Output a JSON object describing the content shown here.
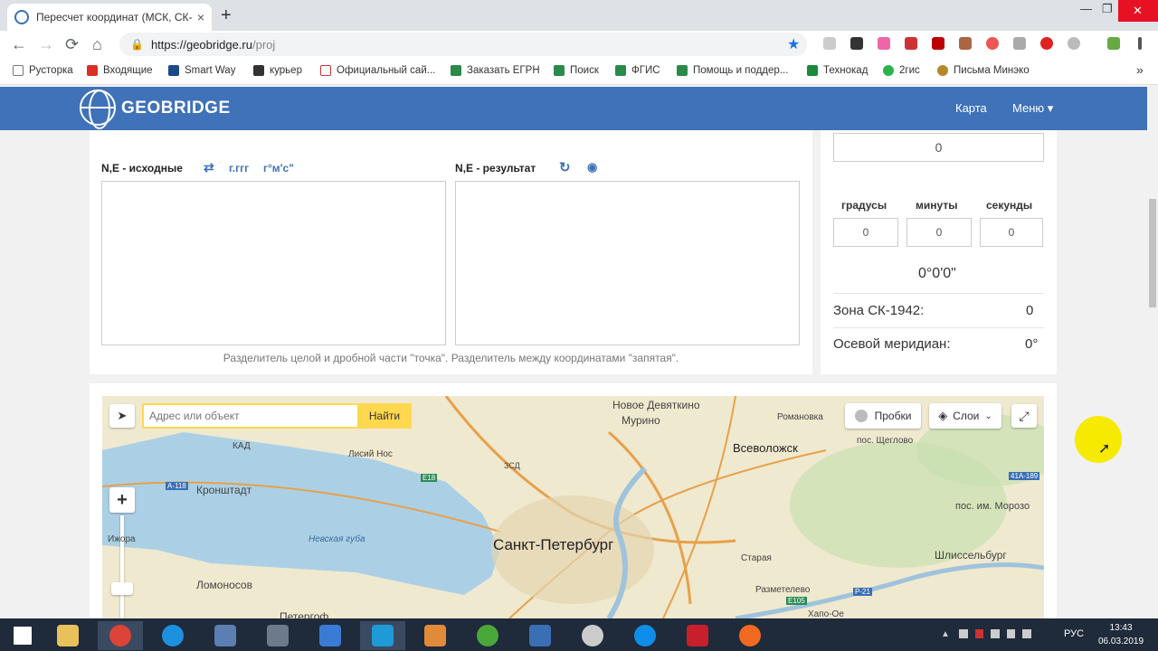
{
  "browser": {
    "tab_title": "Пересчет координат (МСК, СК-",
    "tab_close": "×",
    "new_tab": "+",
    "url_host": "https://geobridge.ru",
    "url_path": "/proj",
    "nav_back": "←",
    "nav_forward": "→",
    "nav_reload": "⟳",
    "nav_home": "⌂",
    "star": "★",
    "lock": "🔒",
    "win_min": "—",
    "win_restore": "❐",
    "win_close": "✕"
  },
  "bookmarks": [
    {
      "label": "Русторка"
    },
    {
      "label": "Входящие"
    },
    {
      "label": "Smart Way"
    },
    {
      "label": "курьер"
    },
    {
      "label": "Официальный сай..."
    },
    {
      "label": "Заказать ЕГРН"
    },
    {
      "label": "Поиск"
    },
    {
      "label": "ФГИС"
    },
    {
      "label": "Помощь и поддер..."
    },
    {
      "label": "Технокад"
    },
    {
      "label": "2гис"
    },
    {
      "label": "Письма Минэко"
    }
  ],
  "bookmarks_more": "»",
  "site": {
    "brand": "GEOBRIDGE",
    "nav_map": "Карта",
    "nav_menu": "Меню ▾"
  },
  "converter": {
    "source_label": "N,E - исходные",
    "swap_icon": "⇄",
    "fmt_decimal": "г.ггг",
    "fmt_dms": "г°м'с\"",
    "result_label": "N,E - результат",
    "refresh_icon": "↻",
    "eye_icon": "◉",
    "hint": "Разделитель целой и дробной части \"точка\". Разделитель между координатами \"запятая\"."
  },
  "angle": {
    "top_value": "0",
    "deg_label": "градусы",
    "min_label": "минуты",
    "sec_label": "секунды",
    "deg_value": "0",
    "min_value": "0",
    "sec_value": "0",
    "dms_display": "0°0'0\"",
    "zone_label": "Зона СК-1942:",
    "zone_value": "0",
    "meridian_label": "Осевой меридиан:",
    "meridian_value": "0°"
  },
  "map": {
    "search_placeholder": "Адрес или объект",
    "search_button": "Найти",
    "traffic": "Пробки",
    "layers": "Слои",
    "zoom_in": "+",
    "locate_icon": "➤",
    "fullscreen_icon": "⤢",
    "labels": [
      {
        "text": "Новое Девяткино"
      },
      {
        "text": "Мурино"
      },
      {
        "text": "Романовка"
      },
      {
        "text": "Всеволожск"
      },
      {
        "text": "пос. Щеглово"
      },
      {
        "text": "КАД"
      },
      {
        "text": "Лисий Нос"
      },
      {
        "text": "Кронштадт"
      },
      {
        "text": "Невская губа"
      },
      {
        "text": "Санкт-Петербург"
      },
      {
        "text": "Старая"
      },
      {
        "text": "Шлиссельбург"
      },
      {
        "text": "пос. им. Морозо"
      },
      {
        "text": "Ломоносов"
      },
      {
        "text": "Разметелево"
      },
      {
        "text": "Ижора"
      },
      {
        "text": "Петергоф"
      },
      {
        "text": "Хапо-Ое"
      },
      {
        "text": "E18"
      },
      {
        "text": "А-118"
      },
      {
        "text": "ЗСД"
      },
      {
        "text": "E105"
      },
      {
        "text": "Р-21"
      },
      {
        "text": "41А-189"
      }
    ]
  },
  "taskbar": {
    "lang": "РУС",
    "time": "13:43",
    "date": "06.03.2019"
  },
  "colors": {
    "header_blue": "#3f72b8",
    "search_yellow": "#ffd84f",
    "taskbar": "#1f2a3a"
  }
}
